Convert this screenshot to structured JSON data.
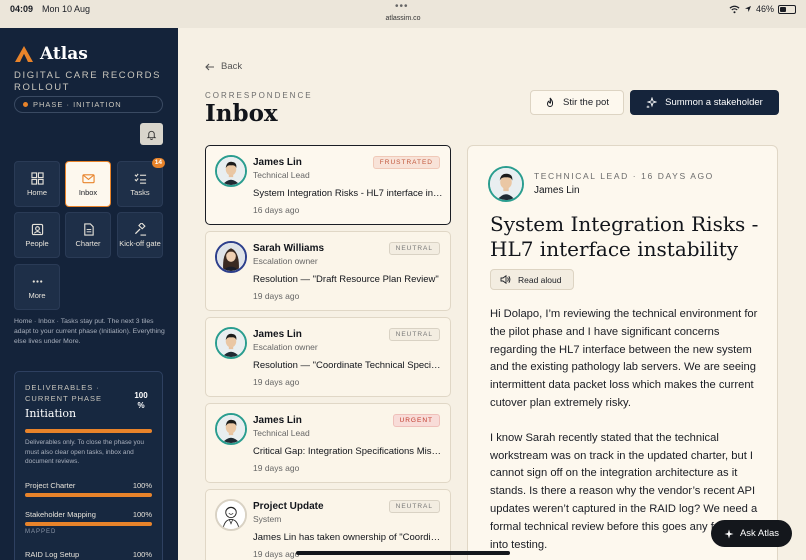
{
  "status": {
    "time": "04:09",
    "date": "Mon 10 Aug",
    "url": "atlassim.co",
    "battery": "46%",
    "battery_level": 0.46
  },
  "sidebar": {
    "brand": "Atlas",
    "subtitle": "DIGITAL CARE RECORDS ROLLOUT",
    "phase_pill": "PHASE · INITIATION",
    "tiles": [
      {
        "label": "Home",
        "icon": "grid-icon"
      },
      {
        "label": "Inbox",
        "icon": "mail-icon",
        "active": true
      },
      {
        "label": "Tasks",
        "icon": "checklist-icon",
        "badge": "14"
      },
      {
        "label": "People",
        "icon": "person-badge-icon"
      },
      {
        "label": "Charter",
        "icon": "document-icon"
      },
      {
        "label": "Kick-off gate",
        "icon": "gavel-icon"
      },
      {
        "label": "More",
        "icon": "more-dots-icon"
      }
    ],
    "nav_note": "Home · Inbox · Tasks stay put. The next 3 tiles adapt to your current phase (Initiation). Everything else lives under More.",
    "deliverables": {
      "label": "DELIVERABLES · CURRENT PHASE",
      "percent": "100 %",
      "percent_value": 100,
      "phase": "Initiation",
      "description": "Deliverables only. To close the phase you must also clear open tasks, inbox and document reviews.",
      "items": [
        {
          "name": "Project Charter",
          "value": "100%",
          "progress": 100
        },
        {
          "name": "Stakeholder Mapping",
          "value": "100%",
          "progress": 100,
          "tag": "MAPPED"
        },
        {
          "name": "RAID Log Setup",
          "value": "100%"
        }
      ]
    }
  },
  "main": {
    "back_label": "Back",
    "section_label": "CORRESPONDENCE",
    "title": "Inbox",
    "stir_label": "Stir the pot",
    "summon_label": "Summon a stakeholder"
  },
  "messages": [
    {
      "name": "James Lin",
      "role": "Technical Lead",
      "tag": "FRUSTRATED",
      "tag_type": "frustrated",
      "subject": "System Integration Risks - HL7 interface instability",
      "ago": "16 days ago",
      "avatar": "man"
    },
    {
      "name": "Sarah Williams",
      "role": "Escalation owner",
      "tag": "NEUTRAL",
      "tag_type": "neutral",
      "subject": "Resolution — \"Draft Resource Plan Review\"",
      "ago": "19 days ago",
      "avatar": "woman"
    },
    {
      "name": "James Lin",
      "role": "Escalation owner",
      "tag": "NEUTRAL",
      "tag_type": "neutral",
      "subject": "Resolution — \"Coordinate Technical Specifications\"",
      "ago": "19 days ago",
      "avatar": "man"
    },
    {
      "name": "James Lin",
      "role": "Technical Lead",
      "tag": "URGENT",
      "tag_type": "urgent",
      "subject": "Critical Gap: Integration Specifications Missing",
      "ago": "19 days ago",
      "avatar": "man"
    },
    {
      "name": "Project Update",
      "role": "System",
      "tag": "NEUTRAL",
      "tag_type": "neutral",
      "subject": "James Lin has taken ownership of \"Coordinate Technical Specifications\"",
      "ago": "19 days ago",
      "avatar": "sketch"
    }
  ],
  "detail": {
    "meta": "TECHNICAL LEAD · 16 DAYS AGO",
    "from": "James Lin",
    "subject": "System Integration Risks - HL7 interface instability",
    "read_aloud": "Read aloud",
    "paragraphs": [
      "Hi Dolapo, I’m reviewing the technical environment for the pilot phase and I have significant concerns regarding the HL7 interface between the new system and the existing pathology lab servers. We are seeing intermittent data packet loss which makes the current cutover plan extremely risky.",
      "I know Sarah recently stated that the technical workstream was on track in the updated charter, but I cannot sign off on the integration architecture as it stands. Is there a reason why the vendor’s recent API updates weren’t captured in the RAID log? We need a formal technical review before this goes any further into testing."
    ]
  },
  "ask_atlas": "Ask Atlas",
  "colors": {
    "sidebar": "#14233a",
    "accent": "#e8832a",
    "page": "#f6f0e4",
    "teal": "#2a9d8f"
  }
}
